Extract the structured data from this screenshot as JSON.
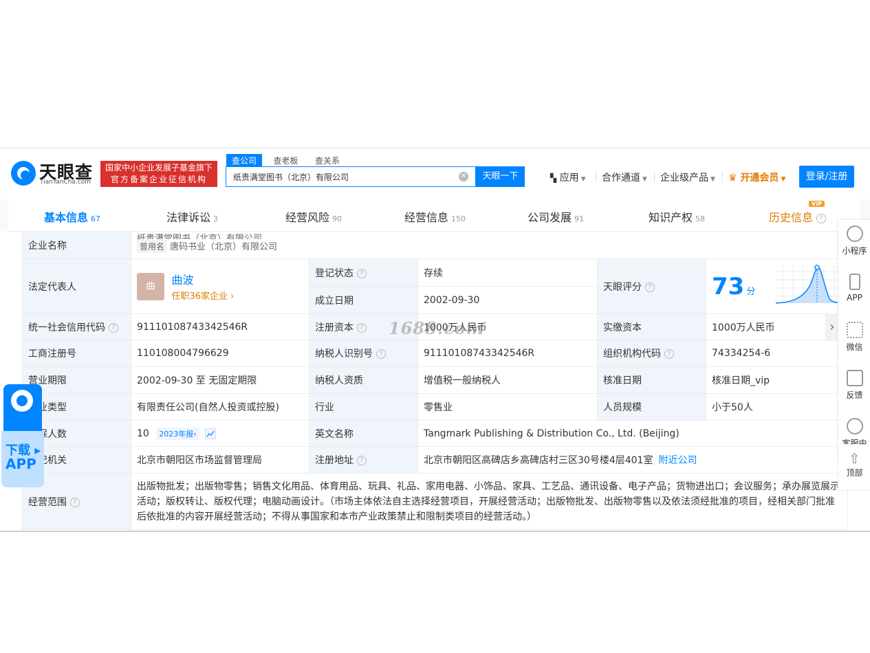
{
  "header": {
    "logo_text": "天眼查",
    "logo_sub": "TianYanCha.com",
    "gov_badge_line1": "国家中小企业发展子基金旗下",
    "gov_badge_line2": "官方备案企业征信机构",
    "search_tabs": [
      "查公司",
      "查老板",
      "查关系"
    ],
    "search_value": "纸贵满堂图书（北京）有限公司",
    "search_button": "天眼一下",
    "nav": {
      "apps": "应用",
      "cooperation": "合作通道",
      "enterprise": "企业级产品",
      "vip": "开通会员",
      "login": "登录/注册"
    }
  },
  "tabs": [
    {
      "label": "基本信息",
      "count": "67"
    },
    {
      "label": "法律诉讼",
      "count": "3"
    },
    {
      "label": "经营风险",
      "count": "90"
    },
    {
      "label": "经营信息",
      "count": "150"
    },
    {
      "label": "公司发展",
      "count": "91"
    },
    {
      "label": "知识产权",
      "count": "58"
    },
    {
      "label": "历史信息",
      "count": ""
    }
  ],
  "vip_badge": "VIP",
  "info": {
    "company_name_label": "企业名称",
    "company_name_cut": "纸贵满堂图书（北京）有限公司",
    "used_name_tag": "曾用名",
    "used_name": "唐码书业（北京）有限公司",
    "legal_rep_label": "法定代表人",
    "avatar_char": "曲",
    "legal_rep_name": "曲波",
    "legal_rep_sub": "任职36家企业 ›",
    "reg_status_label": "登记状态",
    "reg_status": "存续",
    "est_date_label": "成立日期",
    "est_date": "2002-09-30",
    "score_label": "天眼评分",
    "score": "73",
    "score_unit": "分",
    "credit_code_label": "统一社会信用代码",
    "credit_code": "91110108743342546R",
    "reg_capital_label": "注册资本",
    "reg_capital": "1000万人民币",
    "paid_capital_label": "实缴资本",
    "paid_capital": "1000万人民币",
    "biz_reg_no_label": "工商注册号",
    "biz_reg_no": "110108004796629",
    "taxpayer_id_label": "纳税人识别号",
    "taxpayer_id": "91110108743342546R",
    "org_code_label": "组织机构代码",
    "org_code": "74334254-6",
    "term_label": "营业期限",
    "term": "2002-09-30 至 无固定期限",
    "taxpayer_qual_label": "纳税人资质",
    "taxpayer_qual": "增值税一般纳税人",
    "approval_date_label": "核准日期",
    "approval_date": "核准日期_vip",
    "type_label": "企业类型",
    "type": "有限责任公司(自然人投资或控股)",
    "industry_label": "行业",
    "industry": "零售业",
    "staff_size_label": "人员规模",
    "staff_size": "小于50人",
    "insured_label": "参保人数",
    "insured": "10",
    "insured_year": "2023年报›",
    "english_label": "英文名称",
    "english": "Tangmark Publishing & Distribution Co., Ltd. (Beijing)",
    "authority_label": "登记机关",
    "authority": "北京市朝阳区市场监督管理局",
    "address_label": "注册地址",
    "address": "北京市朝阳区高碑店乡高碑店村三区30号楼4层401室",
    "nearby": "附近公司",
    "scope_label": "经营范围",
    "scope": "出版物批发；出版物零售；销售文化用品、体育用品、玩具、礼品、家用电器、小饰品、家具、工艺品、通讯设备、电子产品；货物进出口；会议服务；承办展览展示活动；版权转让、版权代理；电脑动画设计。（市场主体依法自主选择经营项目，开展经营活动；出版物批发、出版物零售以及依法须经批准的项目，经相关部门批准后依批准的内容开展经营活动；不得从事国家和本市产业政策禁止和限制类项目的经营活动。）"
  },
  "right_panel": [
    "小程序",
    "APP",
    "微信",
    "反馈",
    "客服中心"
  ],
  "right_top": "顶部",
  "download": {
    "line1": "下载 ▸",
    "line2": "APP"
  },
  "watermark": "1688.com"
}
